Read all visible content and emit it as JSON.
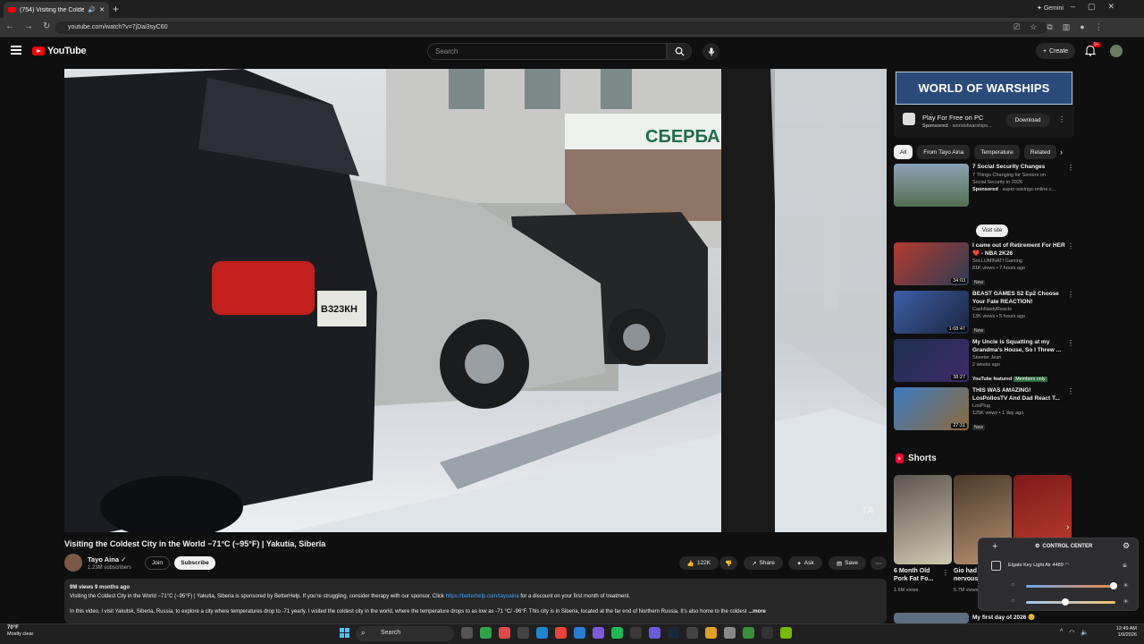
{
  "browser": {
    "tab_title": "(754) Visiting the Coldest C...",
    "url": "youtube.com/watch?v=7jDai3syC60",
    "gemini_label": "Gemini"
  },
  "youtube": {
    "logo_text": "YouTube",
    "search_placeholder": "Search",
    "create_label": "Create",
    "notif_count": "9+"
  },
  "video": {
    "watermark": "TA",
    "title": "Visiting the Coldest City in the World −71°C (−95°F) | Yakutia, Siberia",
    "channel": "Tayo Aina",
    "subscribers": "1.23M subscribers",
    "join_label": "Join",
    "subscribe_label": "Subscribe",
    "likes": "122K",
    "share_label": "Share",
    "ask_label": "Ask",
    "save_label": "Save",
    "desc_meta": "9M views  9 months ago",
    "desc_line1_a": "Visiting the Coldest City in the World −71°C (−95°F) | Yakutia, Siberia is sponsored by BetterHelp. If you're struggling, consider therapy with our sponsor. Click ",
    "desc_link": "https://betterhelp.com/tayoaina",
    "desc_line1_b": " for a discount on your first month of treatment.",
    "desc_line2": "In this video, I visit Yakutsk, Siberia, Russia, to explore a city where temperatures drop to -71 yearly. I visited the coldest city in the world, where the temperature drops to as low as -71 °C/ -96°F. This city is in Siberia, located at the far end of Northern Russia. It's also home to the coldest",
    "more_label": "...more"
  },
  "ad": {
    "banner": "WORLD OF WARSHIPS",
    "title": "Play For Free on PC",
    "sponsor": "Sponsored",
    "domain": "worldofwarships...",
    "download_label": "Download"
  },
  "chips": [
    "All",
    "From Tayo Aina",
    "Temperature",
    "Related"
  ],
  "recs": [
    {
      "title": "7 Social Security Changes",
      "l2": "7 Things Changing for Seniors on",
      "l3": "Social Security in 2026",
      "sponsor": "Sponsored",
      "domain": "super-savings-online.c...",
      "visit": "Visit site",
      "colors": [
        "#8aa2b5",
        "#556e50"
      ]
    },
    {
      "title": "I came out of Retirement For HER ❤️ - NBA 2K26",
      "channel": "SoLLUMINATI Gaming",
      "stats": "81K views • 7 hours ago",
      "badge": "New",
      "duration": "34:03",
      "colors": [
        "#b53a2e",
        "#2d3c55"
      ]
    },
    {
      "title": "BEAST GAMES S2 Ep2 Choose Your Fate REACTION!",
      "channel": "CashNastyReacts",
      "stats": "13K views • 5 hours ago",
      "badge": "New",
      "duration": "1:08:47",
      "colors": [
        "#3d5fa8",
        "#1b2540"
      ]
    },
    {
      "title": "My Uncle is Squatting at my Grandma's House, So I Threw ...",
      "channel": "Skeeter Jean",
      "stats": "2 weeks ago",
      "featured": "YouTube featured",
      "members": "Members only",
      "duration": "38:27",
      "colors": [
        "#1f3050",
        "#3e2a6a"
      ]
    },
    {
      "title": "THIS WAS AMAZING! LosPollosTV And Dad React T...",
      "channel": "LosPlug",
      "stats": "125K views • 1 day ago",
      "badge": "New",
      "duration": "27:31",
      "colors": [
        "#3b7ac0",
        "#8c6a3b"
      ]
    }
  ],
  "shorts": {
    "header": "Shorts",
    "items": [
      {
        "title": "6 Month Old Pork Fat Fo...",
        "views": "1.5M views",
        "colors": [
          "#5b5550",
          "#d0c8b0"
        ]
      },
      {
        "title": "Gio had l... nervous ...",
        "views": "5.7M views",
        "colors": [
          "#4a3a2a",
          "#b69070"
        ]
      },
      {
        "title": "",
        "views": "",
        "colors": [
          "#7d1a1a",
          "#c14030"
        ]
      }
    ],
    "next_title": "My first day of 2026 😊"
  },
  "control_center": {
    "title": "CONTROL CENTER",
    "device": "Elgato Key Light Air 4489",
    "brightness": 0.98,
    "temperature": 0.44
  },
  "taskbar": {
    "weather_temp": "70°F",
    "weather_desc": "Mostly clear",
    "search": "Search",
    "time": "12:49 AM",
    "date": "1/9/2026"
  }
}
